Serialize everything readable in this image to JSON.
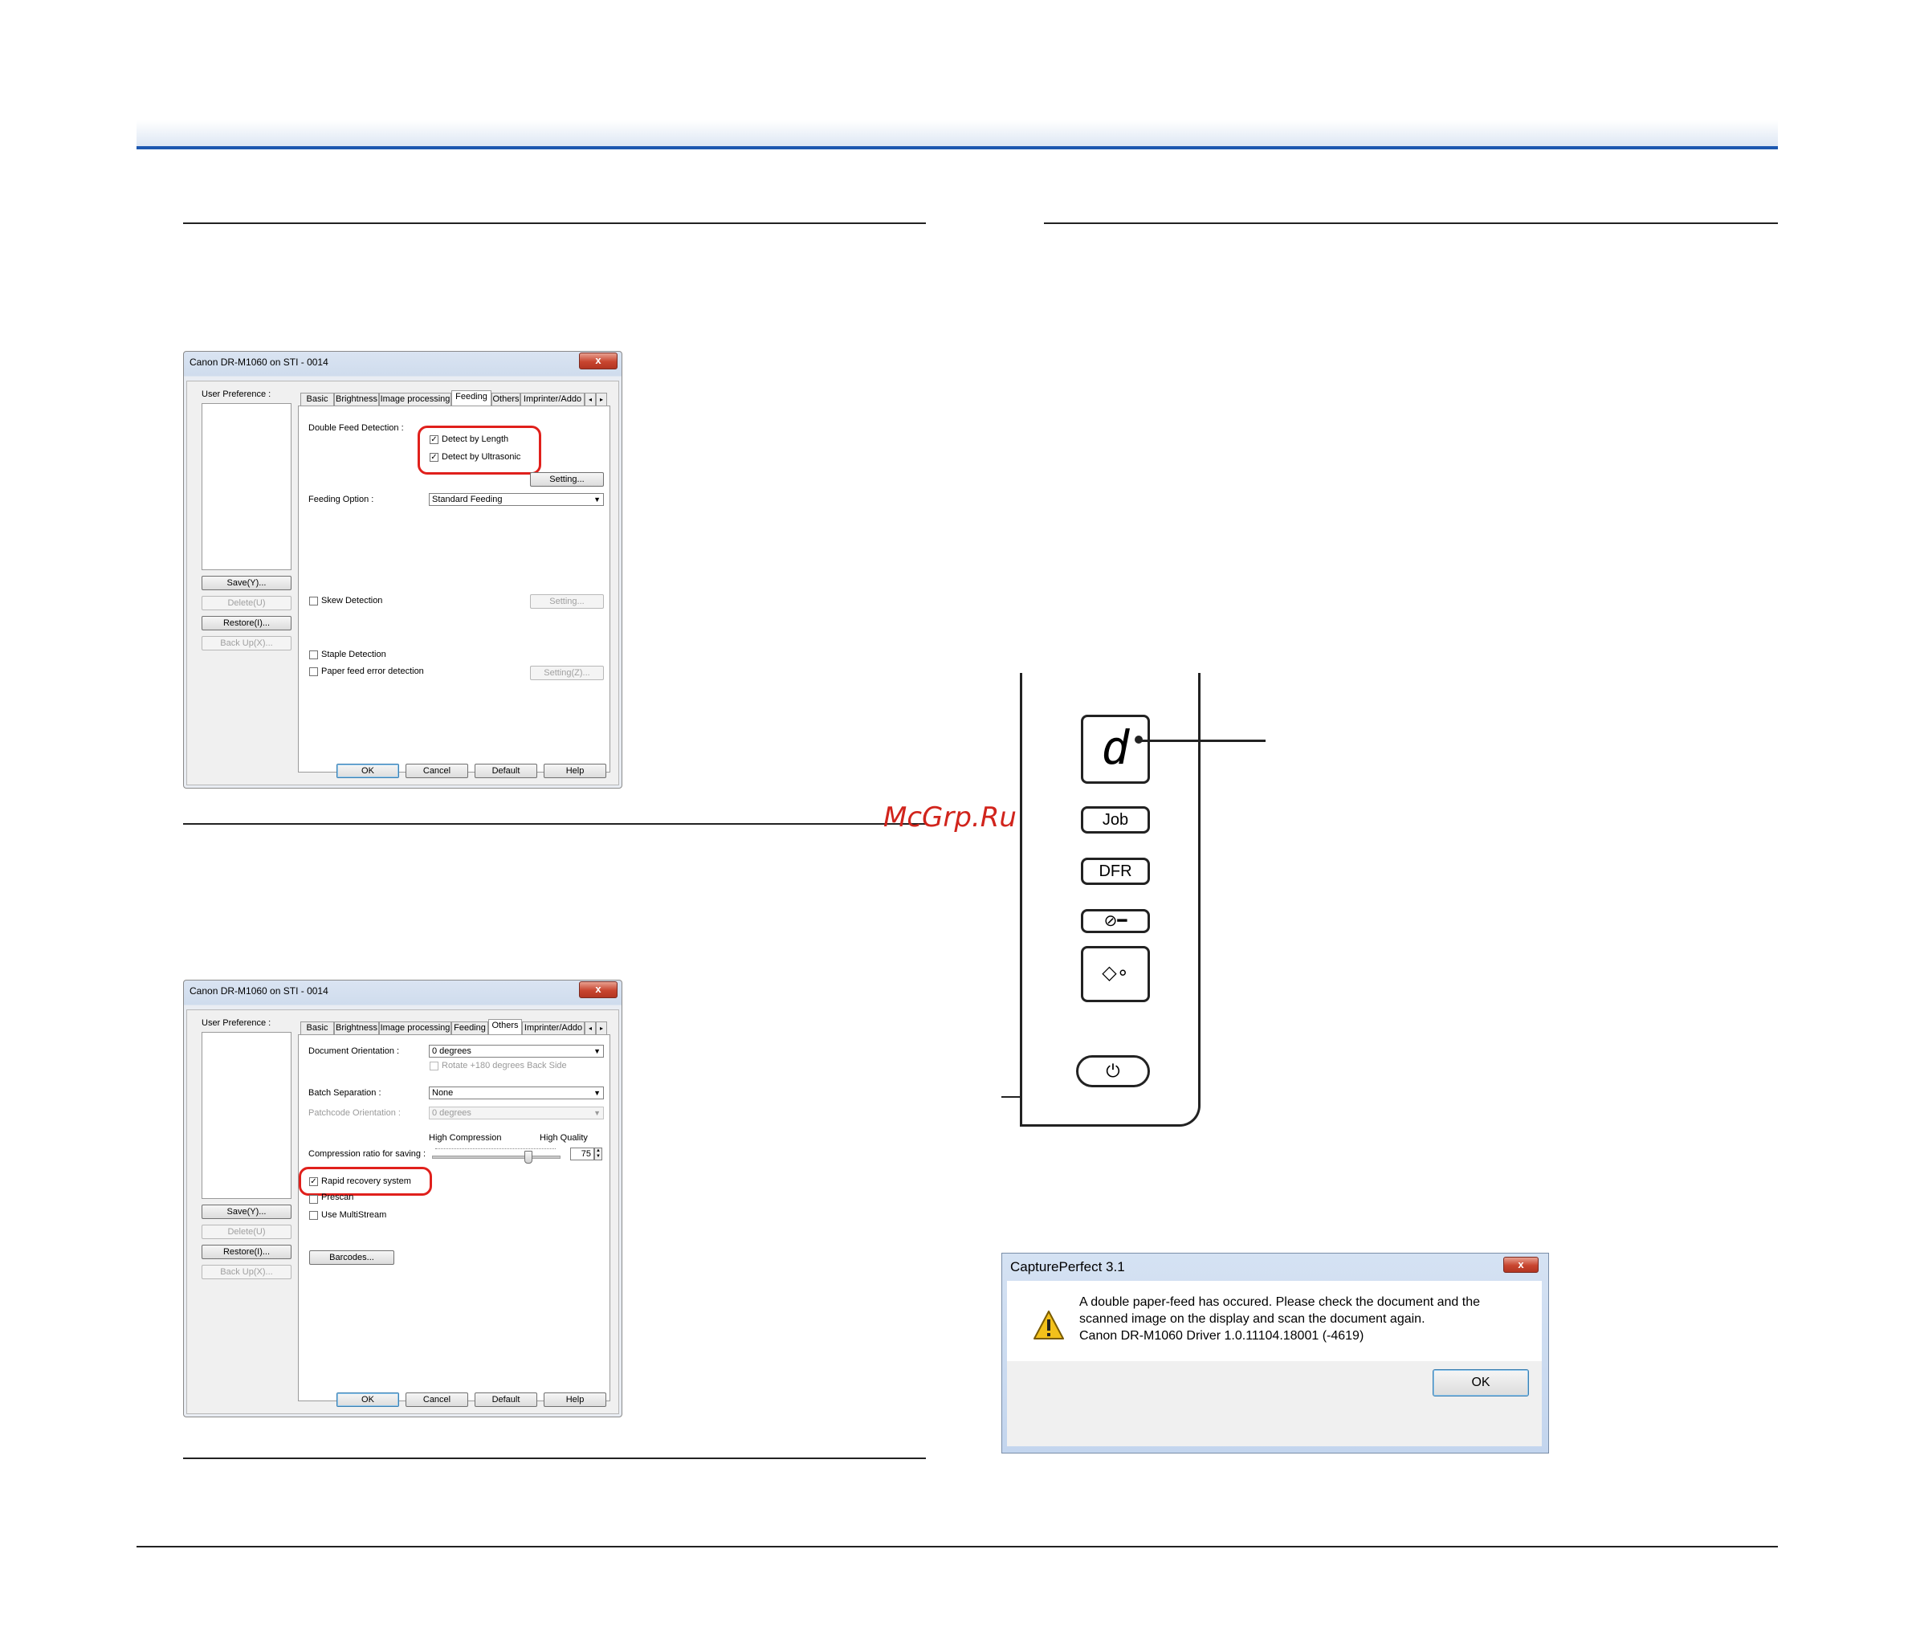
{
  "watermark": "McGrp.Ru",
  "dialog1": {
    "title": "Canon DR-M1060 on STI - 0014",
    "close_label": "x",
    "user_preference_label": "User Preference :",
    "side_buttons": {
      "save": "Save(Y)...",
      "delete": "Delete(U)",
      "restore": "Restore(I)...",
      "backup": "Back Up(X)..."
    },
    "tabs": [
      "Basic",
      "Brightness",
      "Image processing",
      "Feeding",
      "Others",
      "Imprinter/Addo"
    ],
    "active_tab": "Feeding",
    "double_feed_label": "Double Feed Detection :",
    "detect_length": "Detect by Length",
    "detect_ultrasonic": "Detect by Ultrasonic",
    "setting_label": "Setting...",
    "feeding_option_label": "Feeding Option :",
    "feeding_option_value": "Standard Feeding",
    "skew_detection": "Skew Detection",
    "skew_setting": "Setting...",
    "staple_detection": "Staple Detection",
    "paper_feed_error": "Paper feed error detection",
    "paper_setting": "Setting(Z)...",
    "bottom_buttons": {
      "ok": "OK",
      "cancel": "Cancel",
      "default": "Default",
      "help": "Help"
    }
  },
  "dialog2": {
    "title": "Canon DR-M1060 on STI - 0014",
    "close_label": "x",
    "user_preference_label": "User Preference :",
    "side_buttons": {
      "save": "Save(Y)...",
      "delete": "Delete(U)",
      "restore": "Restore(I)...",
      "backup": "Back Up(X)..."
    },
    "tabs": [
      "Basic",
      "Brightness",
      "Image processing",
      "Feeding",
      "Others",
      "Imprinter/Addo"
    ],
    "active_tab": "Others",
    "doc_orientation_label": "Document Orientation :",
    "doc_orientation_value": "0 degrees",
    "rotate_back": "Rotate +180 degrees Back Side",
    "batch_separation_label": "Batch Separation :",
    "batch_separation_value": "None",
    "patchcode_orientation_label": "Patchcode Orientation :",
    "patchcode_orientation_value": "0 degrees",
    "high_compression": "High Compression",
    "high_quality": "High Quality",
    "compression_label": "Compression ratio for saving :",
    "compression_value": "75",
    "compression_level": 0.75,
    "rapid_recovery": "Rapid recovery system",
    "prescan": "Prescan",
    "multistream": "Use MultiStream",
    "barcodes": "Barcodes...",
    "bottom_buttons": {
      "ok": "OK",
      "cancel": "Cancel",
      "default": "Default",
      "help": "Help"
    }
  },
  "panel": {
    "display_char": "d",
    "job": "Job",
    "dfr": "DFR"
  },
  "message_box": {
    "title": "CapturePerfect 3.1",
    "close_label": "x",
    "line1": "A double paper-feed has occured. Please check the document and the",
    "line2": "scanned image on the display and scan the document again.",
    "line3": "Canon DR-M1060 Driver 1.0.11104.18001 (-4619)",
    "ok": "OK"
  },
  "colors": {
    "accent_blue": "#1d58b0",
    "highlight_red": "#e0201c",
    "watermark_red": "#d1241c"
  }
}
